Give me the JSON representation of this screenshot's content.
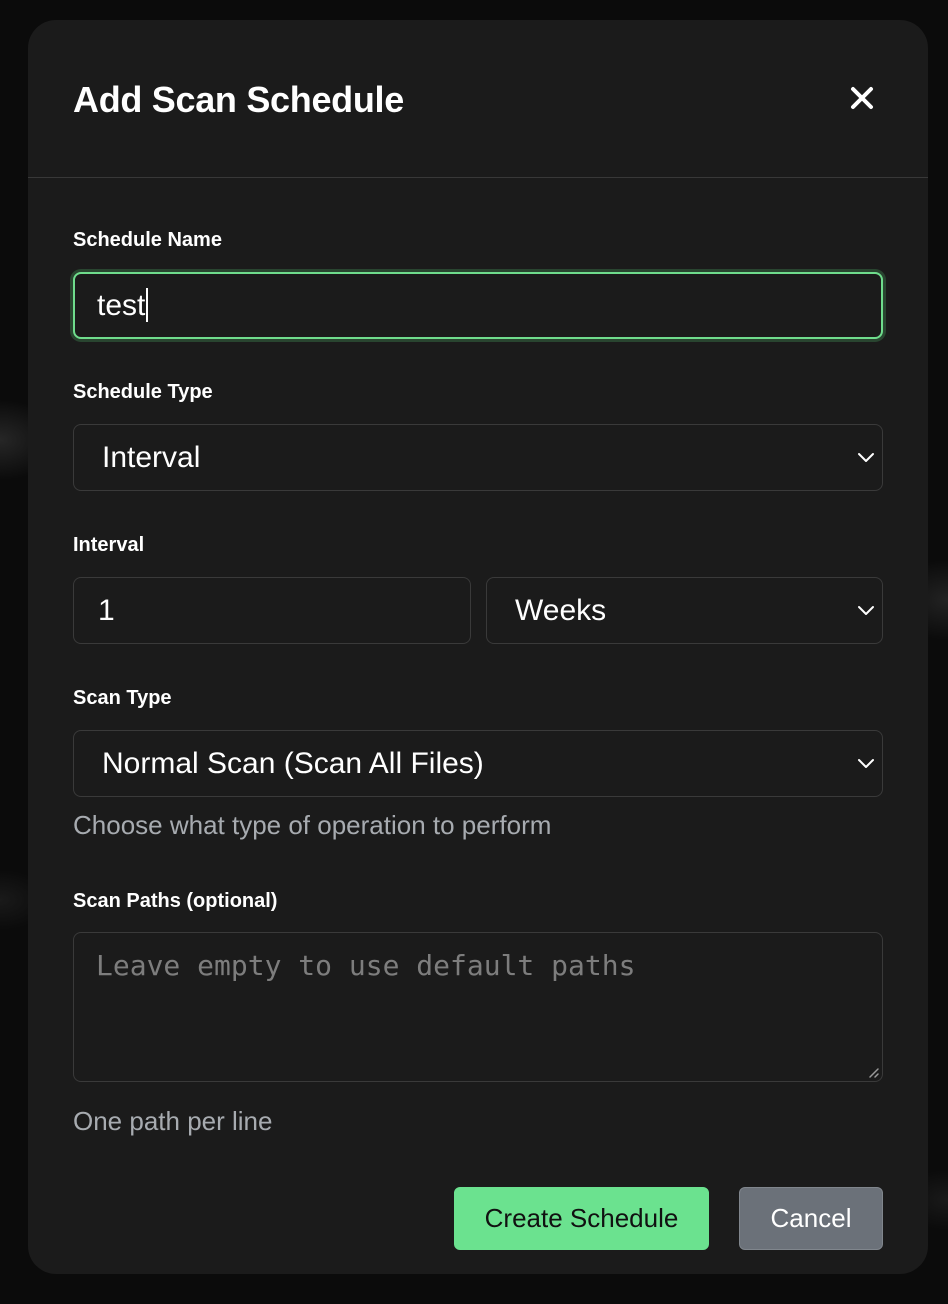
{
  "dialog": {
    "title": "Add Scan Schedule",
    "close_label": "×"
  },
  "schedule_name": {
    "label": "Schedule Name",
    "value": "test"
  },
  "schedule_type": {
    "label": "Schedule Type",
    "selected": "Interval"
  },
  "interval": {
    "label": "Interval",
    "value": "1",
    "unit_selected": "Weeks"
  },
  "scan_type": {
    "label": "Scan Type",
    "selected": "Normal Scan (Scan All Files)",
    "help": "Choose what type of operation to perform"
  },
  "scan_paths": {
    "label": "Scan Paths (optional)",
    "placeholder": "Leave empty to use default paths",
    "help": "One path per line"
  },
  "actions": {
    "create_label": "Create Schedule",
    "cancel_label": "Cancel"
  },
  "colors": {
    "accent": "#6be28f",
    "focus_border": "#6fdc8c",
    "secondary_button": "#6b7179",
    "modal_bg": "#1b1b1b"
  },
  "icons": {
    "close": "close-icon",
    "dropdown": "chevron-down-icon",
    "resize": "resize-handle-icon"
  }
}
